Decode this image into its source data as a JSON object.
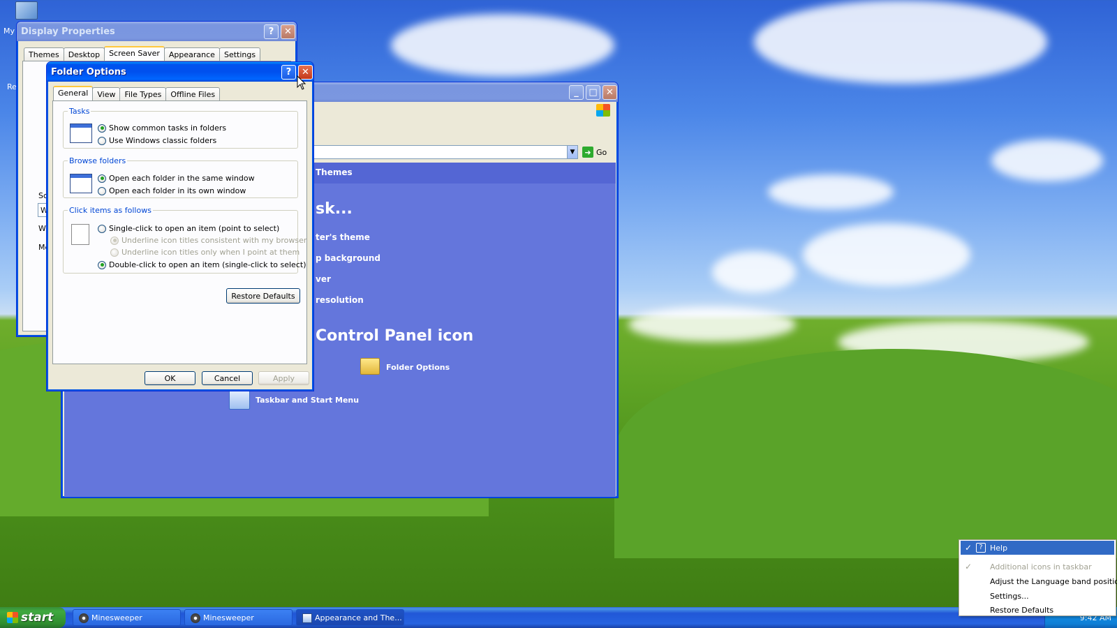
{
  "desktop": {
    "icon_label_my": "My",
    "icon_label_re": "Re"
  },
  "display_properties": {
    "title": "Display Properties",
    "tabs": [
      "Themes",
      "Desktop",
      "Screen Saver",
      "Appearance",
      "Settings"
    ],
    "active_tab": "Screen Saver",
    "fragments": [
      "Sc",
      "W",
      "W",
      "Me"
    ]
  },
  "folder_options": {
    "title": "Folder Options",
    "tabs": [
      "General",
      "View",
      "File Types",
      "Offline Files"
    ],
    "tasks": {
      "legend": "Tasks",
      "options": [
        "Show common tasks in folders",
        "Use Windows classic folders"
      ],
      "selected": 0
    },
    "browse": {
      "legend": "Browse folders",
      "options": [
        "Open each folder in the same window",
        "Open each folder in its own window"
      ],
      "selected": 0
    },
    "click": {
      "legend": "Click items as follows",
      "single": "Single-click to open an item (point to select)",
      "sub1": "Underline icon titles consistent with my browser",
      "sub2": "Underline icon titles only when I point at them",
      "double": "Double-click to open an item (single-click to select)"
    },
    "restore_defaults": "Restore Defaults",
    "ok": "OK",
    "cancel": "Cancel",
    "apply": "Apply"
  },
  "control_panel": {
    "go_label": "Go",
    "themes_header": "Themes",
    "task_heading": "sk...",
    "links": [
      "ter's theme",
      "p background",
      "ver",
      "resolution"
    ],
    "icon_heading": "Control Panel icon",
    "icons": [
      "Folder Options",
      "Taskbar and Start Menu"
    ]
  },
  "taskbar": {
    "start": "start",
    "items": [
      "Minesweeper",
      "Minesweeper",
      "Appearance and The..."
    ],
    "clock": "9:42 AM"
  },
  "context_menu": {
    "items": [
      {
        "label": "Help",
        "checked": true,
        "highlight": true,
        "disabled": false
      },
      {
        "label": "Additional icons in taskbar",
        "checked": true,
        "highlight": false,
        "disabled": true
      },
      {
        "label": "Adjust the Language band position",
        "checked": false,
        "highlight": false,
        "disabled": false
      },
      {
        "label": "Settings...",
        "checked": false,
        "highlight": false,
        "disabled": false
      },
      {
        "label": "Restore Defaults",
        "checked": false,
        "highlight": false,
        "disabled": false
      }
    ]
  },
  "colors": {
    "xp_blue": "#0054e3",
    "cp_background": "#6476dc",
    "legend_blue": "#0046d5",
    "menu_highlight": "#316ac5"
  }
}
